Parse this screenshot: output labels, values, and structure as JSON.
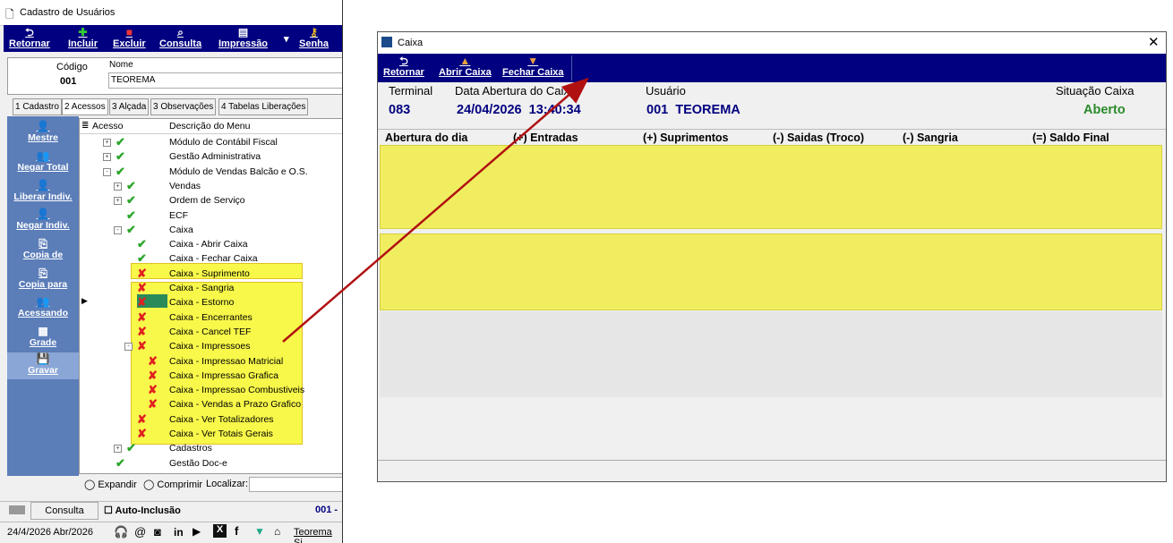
{
  "left_window": {
    "title": "Cadastro de Usuários",
    "toolbar": [
      {
        "label": "Retornar",
        "icon": "return-icon"
      },
      {
        "label": "Incluir",
        "icon": "plus-icon"
      },
      {
        "label": "Excluir",
        "icon": "trash-icon"
      },
      {
        "label": "Consulta",
        "icon": "magnifier-icon"
      },
      {
        "label": "Impressão",
        "icon": "printer-icon"
      },
      {
        "label": "Senha",
        "icon": "key-icon"
      }
    ],
    "form": {
      "codigo_label": "Código",
      "codigo_value": "001",
      "nome_label": "Nome",
      "nome_value": "TEOREMA"
    },
    "tabs": [
      "1 Cadastro",
      "2 Acessos",
      "3 Alçada",
      "3 Observações",
      "4 Tabelas Liberações"
    ],
    "sidebar": [
      {
        "label": "Mestre",
        "icon": "user-icon"
      },
      {
        "label": "Negar Total",
        "icon": "users-deny-icon"
      },
      {
        "label": "Liberar Indiv.",
        "icon": "user-allow-icon"
      },
      {
        "label": "Negar Indiv.",
        "icon": "user-deny-icon"
      },
      {
        "label": "Copia de",
        "icon": "copy-icon"
      },
      {
        "label": "Copia para",
        "icon": "copy-to-icon"
      },
      {
        "label": "Acessando",
        "icon": "group-icon"
      },
      {
        "label": "Grade",
        "icon": "grid-icon"
      },
      {
        "label": "Gravar",
        "icon": "save-icon"
      }
    ],
    "tree_header": {
      "col1": "Acesso",
      "col2": "Descrição do Menu"
    },
    "tree_rows": [
      {
        "label": "Módulo de Contábil Fiscal",
        "state": "ok",
        "level": 1,
        "expander": "+"
      },
      {
        "label": "Gestão Administrativa",
        "state": "ok",
        "level": 1,
        "expander": "+"
      },
      {
        "label": "Módulo de Vendas Balcão e O.S.",
        "state": "ok",
        "level": 1,
        "expander": "-"
      },
      {
        "label": "Vendas",
        "state": "ok",
        "level": 2,
        "expander": "+"
      },
      {
        "label": "Ordem de Serviço",
        "state": "ok",
        "level": 2,
        "expander": "+"
      },
      {
        "label": "ECF",
        "state": "ok",
        "level": 2,
        "expander": ""
      },
      {
        "label": "Caixa",
        "state": "ok",
        "level": 2,
        "expander": "-"
      },
      {
        "label": "Caixa - Abrir Caixa",
        "state": "ok",
        "level": 3,
        "expander": ""
      },
      {
        "label": "Caixa - Fechar Caixa",
        "state": "ok",
        "level": 3,
        "expander": ""
      },
      {
        "label": "Caixa - Suprimento",
        "state": "deny",
        "level": 3,
        "expander": ""
      },
      {
        "label": "Caixa - Sangria",
        "state": "deny",
        "level": 3,
        "expander": ""
      },
      {
        "label": "Caixa - Estorno",
        "state": "deny",
        "level": 3,
        "expander": ""
      },
      {
        "label": "Caixa - Encerrantes",
        "state": "deny",
        "level": 3,
        "expander": ""
      },
      {
        "label": "Caixa - Cancel TEF",
        "state": "deny",
        "level": 3,
        "expander": ""
      },
      {
        "label": "Caixa - Impressoes",
        "state": "deny",
        "level": 3,
        "expander": "-"
      },
      {
        "label": "Caixa - Impressao Matricial",
        "state": "deny",
        "level": 4,
        "expander": ""
      },
      {
        "label": "Caixa - Impressao Grafica",
        "state": "deny",
        "level": 4,
        "expander": ""
      },
      {
        "label": "Caixa - Impressao Combustiveis",
        "state": "deny",
        "level": 4,
        "expander": ""
      },
      {
        "label": "Caixa - Vendas a Prazo Grafico",
        "state": "deny",
        "level": 4,
        "expander": ""
      },
      {
        "label": "Caixa - Ver Totalizadores",
        "state": "deny",
        "level": 3,
        "expander": ""
      },
      {
        "label": "Caixa - Ver Totais Gerais",
        "state": "deny",
        "level": 3,
        "expander": ""
      },
      {
        "label": "Cadastros",
        "state": "ok",
        "level": 2,
        "expander": "+"
      },
      {
        "label": "Gestão Doc-e",
        "state": "ok",
        "level": 1,
        "expander": ""
      }
    ],
    "bottom": {
      "expandir": "Expandir",
      "comprimir": "Comprimir",
      "localizar": "Localizar:"
    },
    "status": {
      "consulta": "Consulta",
      "auto_inclusao": "Auto-Inclusão",
      "record": "001 -"
    },
    "footer": {
      "date": "24/4/2026 Abr/2026",
      "brand": "Teorema Si"
    }
  },
  "right_window": {
    "title": "Caixa",
    "toolbar": [
      {
        "label": "Retornar",
        "icon": "return-icon"
      },
      {
        "label": "Abrir Caixa",
        "icon": "cash-open-icon"
      },
      {
        "label": "Fechar Caixa",
        "icon": "cash-close-icon"
      }
    ],
    "header": {
      "terminal_label": "Terminal",
      "terminal_value": "083",
      "data_label": "Data Abertura do Caixa",
      "data_value": "24/04/2026  13:40:34",
      "usuario_label": "Usuário",
      "usuario_value": "001  TEOREMA",
      "situacao_label": "Situação Caixa",
      "situacao_value": "Aberto"
    },
    "columns": [
      "Abertura do dia",
      "(+) Entradas",
      "(+) Suprimentos",
      "(-) Saidas (Troco)",
      "(-) Sangria",
      "(=) Saldo Final"
    ]
  },
  "colors": {
    "toolbar": "#000080",
    "highlight": "#f0ed60",
    "accent_red": "#b01010",
    "status_green": "#2a8a2a"
  }
}
